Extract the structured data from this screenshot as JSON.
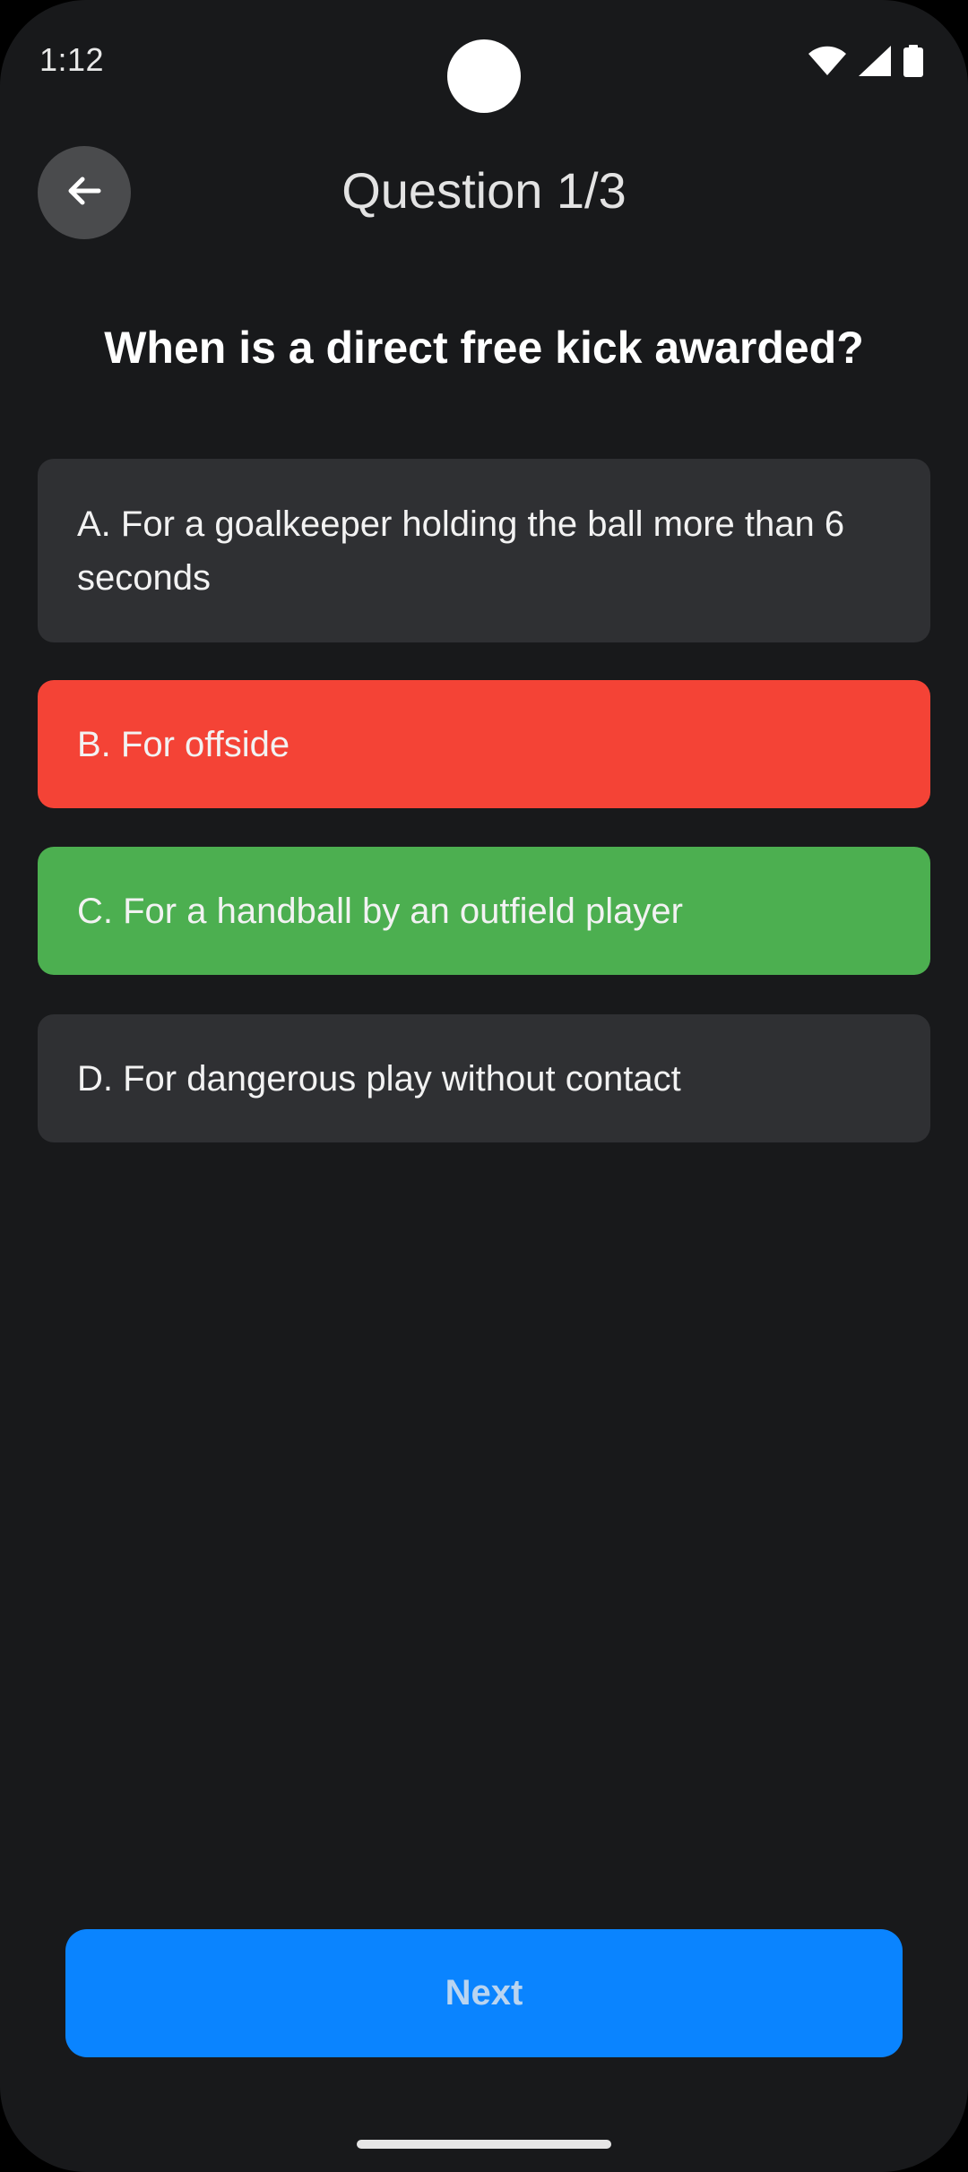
{
  "status_bar": {
    "time": "1:12",
    "icons": [
      "wifi-icon",
      "cellular-signal-icon",
      "battery-icon"
    ]
  },
  "header": {
    "back_icon": "arrow-left-icon",
    "title": "Question 1/3"
  },
  "question": {
    "text": "When is a direct free kick awarded?"
  },
  "answers": [
    {
      "label": "A. For a goalkeeper holding the ball more than 6 seconds",
      "state": "neutral",
      "color": "#2f3033"
    },
    {
      "label": "B. For offside",
      "state": "incorrect",
      "color": "#f44336"
    },
    {
      "label": "C. For a handball by an outfield player",
      "state": "correct",
      "color": "#4caf50"
    },
    {
      "label": "D. For dangerous play without contact",
      "state": "neutral",
      "color": "#2f3033"
    }
  ],
  "footer": {
    "next_label": "Next",
    "next_color": "#0a84ff"
  },
  "theme": {
    "background": "#18191b",
    "text": "#ffffff"
  }
}
